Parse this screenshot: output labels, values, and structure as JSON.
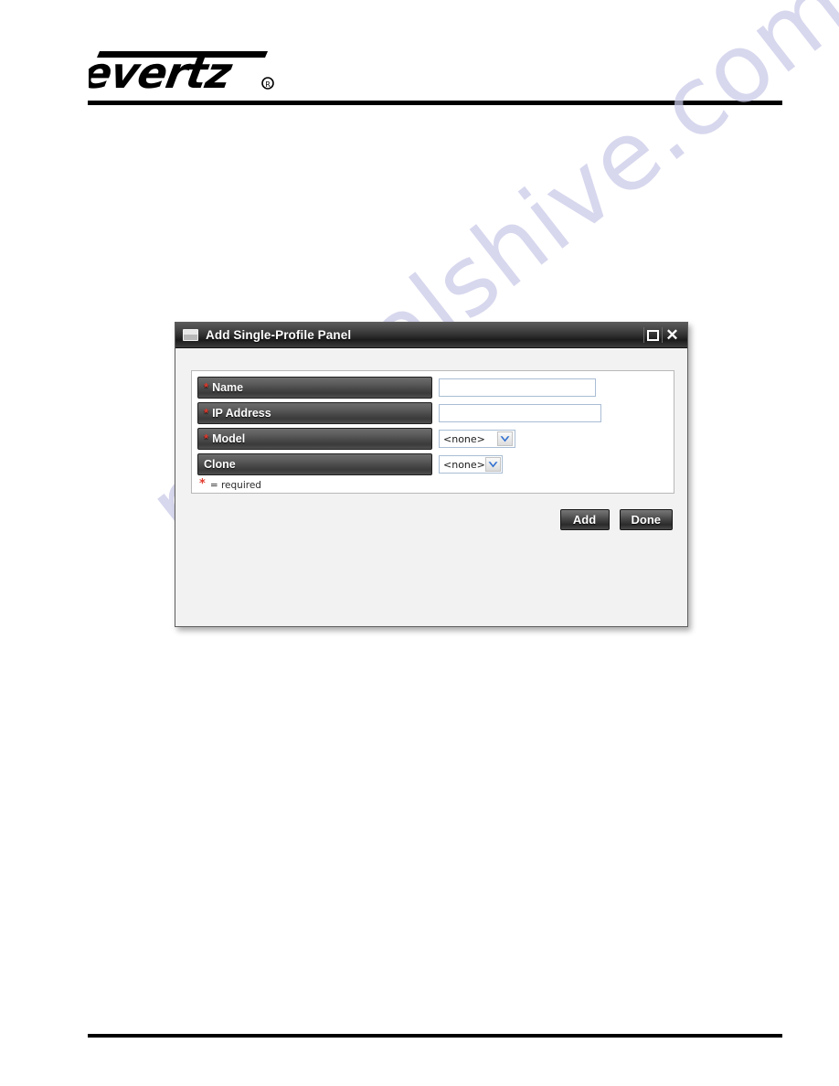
{
  "page": {
    "background": "#ffffff",
    "brand": {
      "name": "evertz",
      "trademark": "®"
    }
  },
  "watermark": {
    "text": "manualshive.com",
    "color": "#c9c9e8"
  },
  "dialog": {
    "title": "Add Single-Profile Panel",
    "icon": "window-icon",
    "title_buttons": [
      {
        "name": "maximize-button",
        "glyph": "□"
      },
      {
        "name": "close-button",
        "glyph": "✕"
      }
    ],
    "form": {
      "rows": [
        {
          "label": "Name",
          "required": true,
          "required_marker": "*",
          "control": "text",
          "value": "",
          "placeholder": ""
        },
        {
          "label": "IP Address",
          "required": true,
          "required_marker": "*",
          "control": "text",
          "value": "",
          "placeholder": ""
        },
        {
          "label": "Model",
          "required": true,
          "required_marker": "*",
          "control": "select",
          "value": "<none>"
        },
        {
          "label": "Clone",
          "required": false,
          "required_marker": "*",
          "control": "select",
          "value": "<none>"
        }
      ],
      "legend": {
        "marker": "*",
        "text": "= required"
      }
    },
    "buttons": [
      {
        "name": "add-button",
        "label": "Add"
      },
      {
        "name": "done-button",
        "label": "Done"
      }
    ]
  }
}
